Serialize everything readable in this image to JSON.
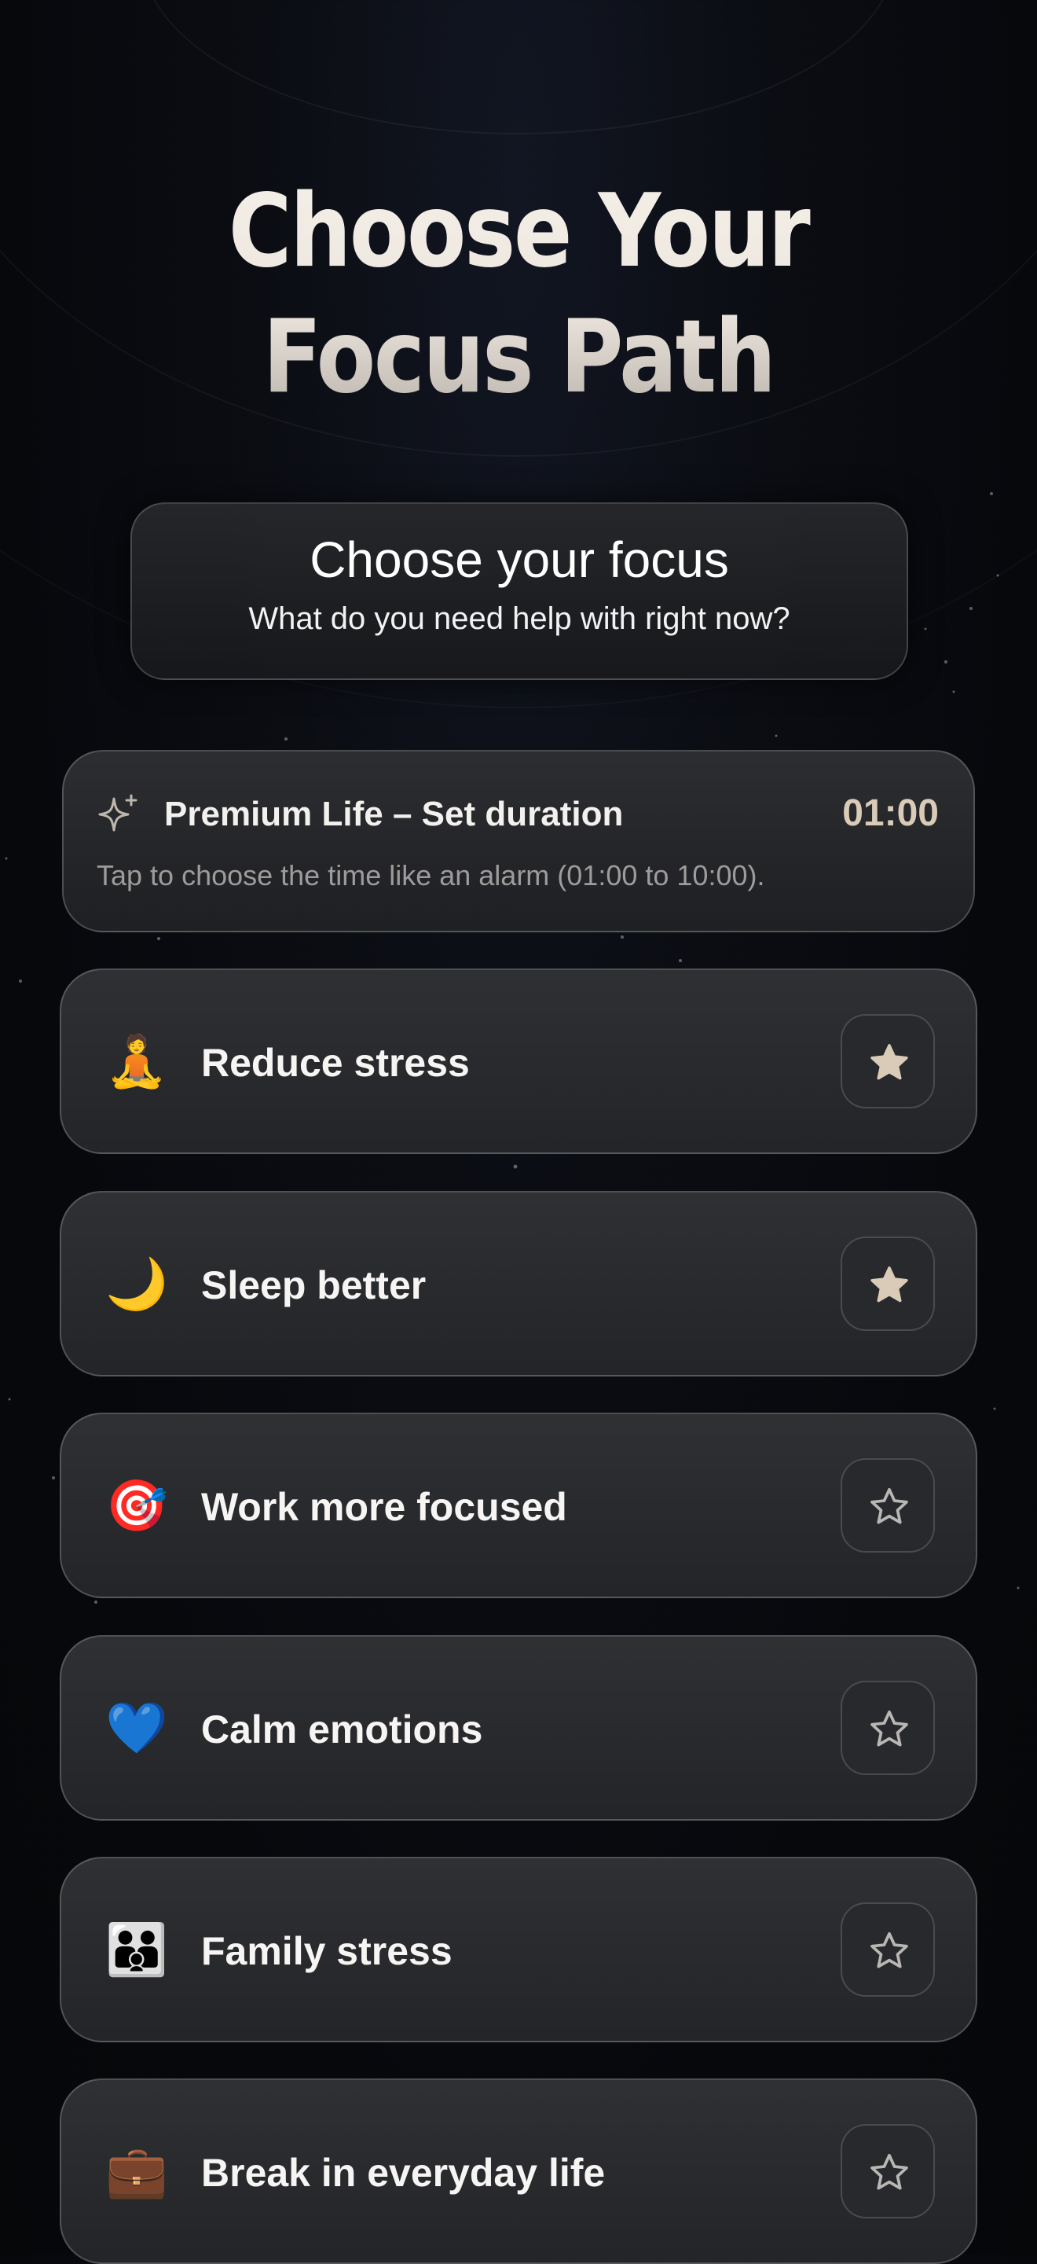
{
  "header": {
    "title_line1": "Choose Your",
    "title_line2": "Focus Path"
  },
  "focus_card": {
    "title": "Choose your focus",
    "subtitle": "What do you need help with right now?"
  },
  "premium": {
    "icon": "sparkle-icon",
    "title": "Premium Life – Set duration",
    "time": "01:00",
    "description": "Tap to choose the time like an alarm (01:00 to 10:00).",
    "accent_color": "#d9cbb8"
  },
  "options": [
    {
      "emoji": "🧘",
      "icon": "meditation-icon",
      "label": "Reduce stress",
      "favorite": true
    },
    {
      "emoji": "🌙",
      "icon": "moon-icon",
      "label": "Sleep better",
      "favorite": true
    },
    {
      "emoji": "🎯",
      "icon": "target-icon",
      "label": "Work more focused",
      "favorite": false
    },
    {
      "emoji": "💙",
      "icon": "blue-heart-icon",
      "label": "Calm emotions",
      "favorite": false
    },
    {
      "emoji": "👪",
      "icon": "family-icon",
      "label": "Family stress",
      "favorite": false
    },
    {
      "emoji": "💼",
      "icon": "briefcase-icon",
      "label": "Break in everyday life",
      "favorite": false
    }
  ],
  "colors": {
    "background": "#07080c",
    "star_filled": "#d9cbb8",
    "star_outline": "#b9b7b4"
  }
}
